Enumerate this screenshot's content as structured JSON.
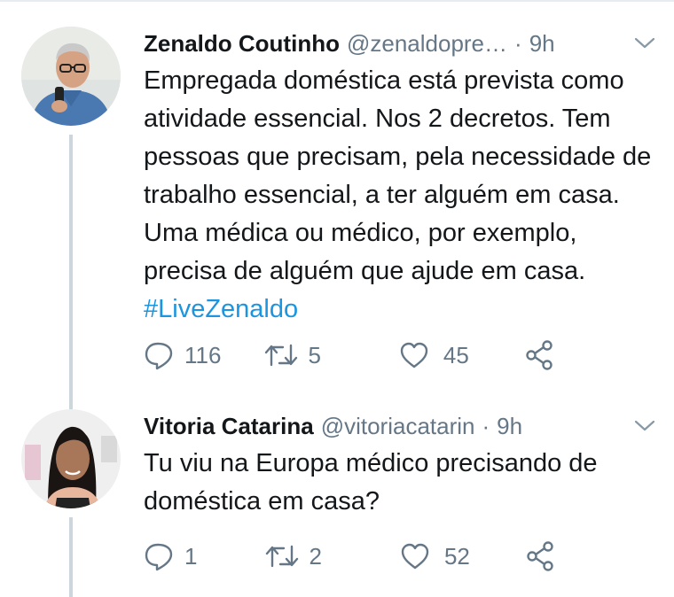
{
  "tweets": [
    {
      "name": "Zenaldo Coutinho",
      "handle": "@zenaldopre…",
      "dot": "·",
      "time": "9h",
      "text": "Empregada doméstica está prevista como atividade essencial. Nos 2 decretos. Tem pessoas que precisam, pela necessidade de trabalho essencial, a ter alguém em casa. Uma médica ou médico, por exemplo, precisa de alguém que ajude em casa.",
      "hashtag": "#LiveZenaldo",
      "replies": "116",
      "retweets": "5",
      "likes": "45"
    },
    {
      "name": "Vitoria Catarina",
      "handle": "@vitoriacatarin",
      "dot": "·",
      "time": "9h",
      "text": "Tu viu na Europa médico precisando de doméstica em casa?",
      "replies": "1",
      "retweets": "2",
      "likes": "52"
    }
  ],
  "colors": {
    "text": "#14171a",
    "secondary": "#657786",
    "link": "#1b95e0",
    "thread_line": "#ccd6dd"
  },
  "icons": [
    "reply-icon",
    "retweet-icon",
    "like-icon",
    "share-icon",
    "chevron-down-icon"
  ]
}
